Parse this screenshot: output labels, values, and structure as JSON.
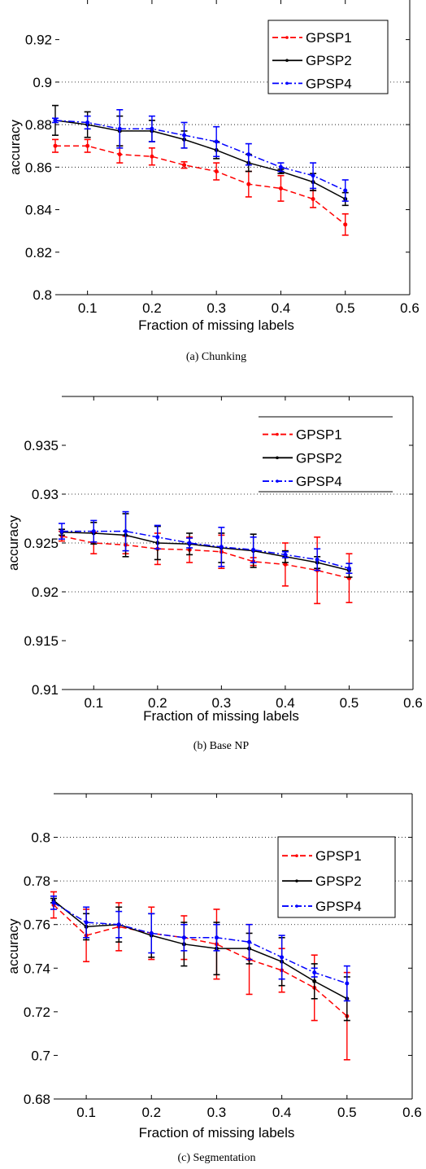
{
  "chart_data": [
    {
      "type": "line",
      "id": "chunking",
      "caption": "(a) Chunking",
      "xlabel": "Fraction of missing labels",
      "ylabel": "accuracy",
      "xlim": [
        0.05,
        0.6
      ],
      "ylim": [
        0.8,
        0.939
      ],
      "xticks": [
        0.1,
        0.2,
        0.3,
        0.4,
        0.5,
        0.6
      ],
      "xtick_labels": [
        "0.1",
        "0.2",
        "0.3",
        "0.4",
        "0.5",
        "0.6"
      ],
      "yticks": [
        0.8,
        0.82,
        0.84,
        0.86,
        0.88,
        0.9,
        0.92
      ],
      "ytick_labels": [
        "0.8",
        "0.82",
        "0.84",
        "0.86",
        "0.88",
        "0.9",
        "0.92"
      ],
      "grid_y": [
        0.86,
        0.88,
        0.9
      ],
      "legend": {
        "placement": "top-right",
        "boxed": true
      },
      "x": [
        0.05,
        0.1,
        0.15,
        0.2,
        0.25,
        0.3,
        0.35,
        0.4,
        0.45,
        0.5
      ],
      "series": [
        {
          "name": "GPSP1",
          "color": "#ff0000",
          "style": "dashed",
          "values": [
            0.87,
            0.87,
            0.866,
            0.865,
            0.861,
            0.858,
            0.852,
            0.85,
            0.845,
            0.833
          ],
          "err": [
            0.003,
            0.003,
            0.004,
            0.004,
            0.0015,
            0.004,
            0.006,
            0.006,
            0.004,
            0.005
          ]
        },
        {
          "name": "GPSP2",
          "color": "#000000",
          "style": "solid",
          "values": [
            0.882,
            0.88,
            0.877,
            0.877,
            0.873,
            0.868,
            0.862,
            0.858,
            0.853,
            0.845
          ],
          "err": [
            0.007,
            0.006,
            0.007,
            0.005,
            0.004,
            0.004,
            0.004,
            0.001,
            0.004,
            0.003
          ]
        },
        {
          "name": "GPSP4",
          "color": "#0000ff",
          "style": "dashdot",
          "values": [
            0.882,
            0.881,
            0.878,
            0.878,
            0.875,
            0.872,
            0.866,
            0.86,
            0.856,
            0.849
          ],
          "err": [
            0.001,
            0.003,
            0.009,
            0.006,
            0.006,
            0.007,
            0.005,
            0.002,
            0.006,
            0.005
          ]
        }
      ]
    },
    {
      "type": "line",
      "id": "base-np",
      "caption": "(b) Base NP",
      "xlabel": "Fraction of missing labels",
      "ylabel": "accuracy",
      "xlim": [
        0.05,
        0.6
      ],
      "ylim": [
        0.91,
        0.94
      ],
      "xticks": [
        0.1,
        0.2,
        0.3,
        0.4,
        0.5,
        0.6
      ],
      "xtick_labels": [
        "0.1",
        "0.2",
        "0.3",
        "0.4",
        "0.5",
        "0.6"
      ],
      "yticks": [
        0.91,
        0.915,
        0.92,
        0.925,
        0.93,
        0.935
      ],
      "ytick_labels": [
        "0.91",
        "0.915",
        "0.92",
        "0.925",
        "0.93",
        "0.935"
      ],
      "grid_y": [
        0.92,
        0.925,
        0.93
      ],
      "legend": {
        "placement": "top-right",
        "boxed": false
      },
      "x": [
        0.05,
        0.1,
        0.15,
        0.2,
        0.25,
        0.3,
        0.35,
        0.4,
        0.45,
        0.5
      ],
      "series": [
        {
          "name": "GPSP1",
          "color": "#ff0000",
          "style": "dashed",
          "values": [
            0.9257,
            0.925,
            0.9248,
            0.9244,
            0.9243,
            0.9241,
            0.9231,
            0.9228,
            0.9222,
            0.9214
          ],
          "err": [
            0.0005,
            0.0011,
            0.0009,
            0.0016,
            0.0013,
            0.0017,
            0.0004,
            0.0022,
            0.0034,
            0.0025
          ]
        },
        {
          "name": "GPSP2",
          "color": "#000000",
          "style": "solid",
          "values": [
            0.9261,
            0.926,
            0.9258,
            0.925,
            0.9249,
            0.9245,
            0.9242,
            0.9236,
            0.923,
            0.9222
          ],
          "err": [
            0.0003,
            0.0011,
            0.0022,
            0.0017,
            0.0011,
            0.0015,
            0.0017,
            0.0006,
            0.0006,
            0.0007
          ]
        },
        {
          "name": "GPSP4",
          "color": "#0000ff",
          "style": "dashdot",
          "values": [
            0.9262,
            0.9262,
            0.9262,
            0.9256,
            0.925,
            0.9246,
            0.9243,
            0.9238,
            0.9233,
            0.9224
          ],
          "err": [
            0.0008,
            0.0011,
            0.002,
            0.0012,
            0.0005,
            0.002,
            0.0013,
            0.0003,
            0.0011,
            0.0005
          ]
        }
      ]
    },
    {
      "type": "line",
      "id": "segmentation",
      "caption": "(c) Segmentation",
      "xlabel": "Fraction of  missing labels",
      "ylabel": "accuracy",
      "xlim": [
        0.05,
        0.6
      ],
      "ylim": [
        0.68,
        0.82
      ],
      "xticks": [
        0.1,
        0.2,
        0.3,
        0.4,
        0.5,
        0.6
      ],
      "xtick_labels": [
        "0.1",
        "0.2",
        "0.3",
        "0.4",
        "0.5",
        "0.6"
      ],
      "yticks": [
        0.68,
        0.7,
        0.72,
        0.74,
        0.76,
        0.78,
        0.8
      ],
      "ytick_labels": [
        "0.68",
        "0.7",
        "0.72",
        "0.74",
        "0.76",
        "0.78",
        "0.8"
      ],
      "grid_y": [
        0.76,
        0.78,
        0.8
      ],
      "legend": {
        "placement": "top-right",
        "boxed": true
      },
      "x": [
        0.05,
        0.1,
        0.15,
        0.2,
        0.25,
        0.3,
        0.35,
        0.4,
        0.45,
        0.5
      ],
      "series": [
        {
          "name": "GPSP1",
          "color": "#ff0000",
          "style": "dashed",
          "values": [
            0.769,
            0.755,
            0.759,
            0.756,
            0.754,
            0.751,
            0.744,
            0.739,
            0.731,
            0.718
          ],
          "err": [
            0.006,
            0.012,
            0.011,
            0.012,
            0.01,
            0.016,
            0.016,
            0.01,
            0.015,
            0.02
          ]
        },
        {
          "name": "GPSP2",
          "color": "#000000",
          "style": "solid",
          "values": [
            0.771,
            0.759,
            0.76,
            0.755,
            0.751,
            0.749,
            0.749,
            0.743,
            0.734,
            0.726
          ],
          "err": [
            0.001,
            0.006,
            0.008,
            0.01,
            0.01,
            0.012,
            0.007,
            0.011,
            0.008,
            0.01
          ]
        },
        {
          "name": "GPSP4",
          "color": "#0000ff",
          "style": "dashdot",
          "values": [
            0.77,
            0.761,
            0.76,
            0.756,
            0.754,
            0.754,
            0.752,
            0.745,
            0.738,
            0.733
          ],
          "err": [
            0.003,
            0.007,
            0.006,
            0.009,
            0.006,
            0.006,
            0.008,
            0.01,
            0.002,
            0.008
          ]
        }
      ]
    }
  ]
}
